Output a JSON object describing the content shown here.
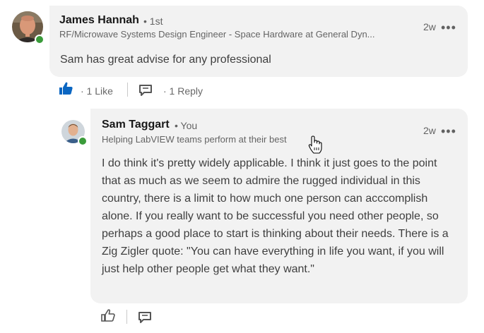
{
  "comment": {
    "author_name": "James Hannah",
    "degree": "• 1st",
    "headline": "RF/Microwave Systems Design Engineer - Space Hardware at General Dyn...",
    "timestamp": "2w",
    "text": "Sam has great advise for any professional",
    "likes_label": "· 1 Like",
    "replies_label": "· 1 Reply",
    "liked": true
  },
  "reply": {
    "author_name": "Sam Taggart",
    "degree": "• You",
    "headline": "Helping LabVIEW teams perform at their best",
    "timestamp": "2w",
    "text": "I do think it's pretty widely applicable.  I think it just goes to the point that as much as we seem to admire the rugged individual in this country, there is a limit to how much one person can acccomplish alone. If you really want to be successful you need other people, so perhaps a good place to start is thinking about their needs.  There is a Zig Zigler quote: \"You can have everything in life you want, if you will just help other people get what they want.\""
  },
  "colors": {
    "bubble_bg": "#f2f2f2",
    "like_active": "#0a66c2",
    "online_dot": "#3a9b3a",
    "muted_text": "#666666"
  },
  "icons": {
    "like": "thumbs-up-icon",
    "reply": "speech-bubble-icon",
    "more": "ellipsis-icon",
    "cursor": "hand-pointer-icon"
  }
}
